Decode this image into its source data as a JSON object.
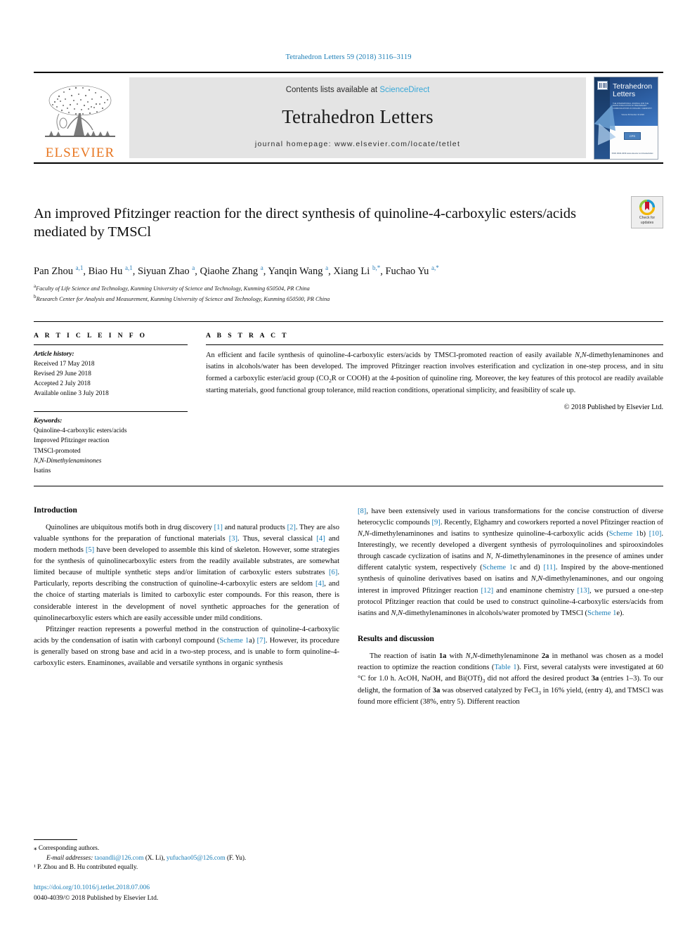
{
  "running_head": "Tetrahedron Letters 59 (2018) 3116–3119",
  "masthead": {
    "publisher_word": "ELSEVIER",
    "contents_prefix": "Contents lists available at ",
    "contents_link": "ScienceDirect",
    "journal_name": "Tetrahedron Letters",
    "homepage_prefix": "journal homepage: ",
    "homepage_url": "www.elsevier.com/locate/tetlet",
    "cover": {
      "title_line1": "Tetrahedron",
      "title_line2": "Letters",
      "sub_line": "THE INTERNATIONAL JOURNAL FOR THE RAPID PUBLICATION OF PRELIMINARY COMMUNICATIONS IN ORGANIC CHEMISTRY",
      "volume_line": "Volume 59   Number 33   2018",
      "blurb": "Available online at www.sciencedirect.com — rapid publication of preliminary communications in organic chemistry",
      "chip_label": "CPS",
      "foot_line": "ISSN 0040-4039\nwww.elsevier.com/locate/tetlet"
    }
  },
  "title": "An improved Pfitzinger reaction for the direct synthesis of quinoline-4-carboxylic esters/acids mediated by TMSCl",
  "crossmark": {
    "label_line1": "Check for",
    "label_line2": "updates"
  },
  "authors_html": "Pan Zhou <sup>a,1</sup>, Biao Hu <sup>a,1</sup>, Siyuan Zhao <sup>a</sup>, Qiaohe Zhang <sup>a</sup>, Yanqin Wang <sup>a</sup>, Xiang Li <sup>b,*</sup>, Fuchao Yu <sup>a,*</sup>",
  "affiliations": [
    {
      "marker": "a",
      "text": "Faculty of Life Science and Technology, Kunming University of Science and Technology, Kunming 650504, PR China"
    },
    {
      "marker": "b",
      "text": "Research Center for Analysis and Measurement, Kunming University of Science and Technology, Kunming 650500, PR China"
    }
  ],
  "article_info": {
    "heading": "A R T I C L E  I N F O",
    "history_label": "Article history:",
    "history": [
      "Received 17 May 2018",
      "Revised 29 June 2018",
      "Accepted 2 July 2018",
      "Available online 3 July 2018"
    ],
    "keywords_label": "Keywords:",
    "keywords": [
      "Quinoline-4-carboxylic esters/acids",
      "Improved Pfitzinger reaction",
      "TMSCl-promoted",
      "N,N-Dimethylenaminones",
      "Isatins"
    ]
  },
  "abstract": {
    "heading": "A B S T R A C T",
    "text_html": "An efficient and facile synthesis of quinoline-4-carboxylic esters/acids by TMSCl-promoted reaction of easily available <em>N,N</em>-dimethylenaminones and isatins in alcohols/water has been developed. The improved Pfitzinger reaction involves esterification and cyclization in one-step process, and in situ formed a carboxylic ester/acid group (CO<sub>2</sub>R or COOH) at the 4-position of quinoline ring. Moreover, the key features of this protocol are readily available starting materials, good functional group tolerance, mild reaction conditions, operational simplicity, and feasibility of scale up.",
    "copyright": "© 2018 Published by Elsevier Ltd."
  },
  "sections": {
    "introduction_heading": "Introduction",
    "intro_p1_html": "Quinolines are ubiquitous motifs both in drug discovery <span class=\"ref\">[1]</span> and natural products <span class=\"ref\">[2]</span>. They are also valuable synthons for the preparation of functional materials <span class=\"ref\">[3]</span>. Thus, several classical <span class=\"ref\">[4]</span> and modern methods <span class=\"ref\">[5]</span> have been developed to assemble this kind of skeleton. However, some strategies for the synthesis of quinolinecarboxylic esters from the readily available substrates, are somewhat limited because of multiple synthetic steps and/or limitation of carboxylic esters substrates <span class=\"ref\">[6]</span>. Particularly, reports describing the construction of quinoline-4-carboxylic esters are seldom <span class=\"ref\">[4]</span>, and the choice of starting materials is limited to carboxylic ester compounds. For this reason, there is considerable interest in the development of novel synthetic approaches for the generation of quinolinecarboxylic esters which are easily accessible under mild conditions.",
    "intro_p2_html": "Pfitzinger reaction represents a powerful method in the construction of quinoline-4-carboxylic acids by the condensation of isatin with carbonyl compound (<span class=\"lnk\">Scheme 1</span>a) <span class=\"ref\">[7]</span>. However, its procedure is generally based on strong base and acid in a two-step process, and is unable to form quinoline-4-carboxylic esters. Enaminones, available and versatile synthons in organic synthesis",
    "intro_p2_cont_html": "<span class=\"ref\">[8]</span>, have been extensively used in various transformations for the concise construction of diverse heterocyclic compounds <span class=\"ref\">[9]</span>. Recently, Elghamry and coworkers reported a novel Pfitzinger reaction of <em>N,N</em>-dimethylenaminones and isatins to synthesize quinoline-4-carboxylic acids (<span class=\"lnk\">Scheme 1</span>b) <span class=\"ref\">[10]</span>. Interestingly, we recently developed a divergent synthesis of pyrroloquinolines and spirooxindoles through cascade cyclization of isatins and <em>N, N</em>-dimethylenaminones in the presence of amines under different catalytic system, respectively (<span class=\"lnk\">Scheme 1</span>c and d) <span class=\"ref\">[11]</span>. Inspired by the above-mentioned synthesis of quinoline derivatives based on isatins and <em>N,N</em>-dimethylenaminones, and our ongoing interest in improved Pfitzinger reaction <span class=\"ref\">[12]</span> and enaminone chemistry <span class=\"ref\">[13]</span>, we pursued a one-step protocol Pfitzinger reaction that could be used to construct quinoline-4-carboxylic esters/acids from isatins and <em>N,N</em>-dimethylenaminones in alcohols/water promoted by TMSCl (<span class=\"lnk\">Scheme 1</span>e).",
    "results_heading": "Results and discussion",
    "results_p1_html": "The reaction of isatin <strong>1a</strong> with <em>N,N</em>-dimethylenaminone <strong>2a</strong> in methanol was chosen as a model reaction to optimize the reaction conditions (<span class=\"lnk\">Table 1</span>). First, several catalysts were investigated at 60 °C for 1.0 h. AcOH, NaOH, and Bi(OTf)<sub>3</sub> did not afford the desired product <strong>3a</strong> (entries 1–3). To our delight, the formation of <strong>3a</strong> was observed catalyzed by FeCl<sub>3</sub> in 16% yield, (entry 4), and TMSCl was found more efficient (38%, entry 5). Different reaction"
  },
  "footnotes": {
    "corresponding": "⁎ Corresponding authors.",
    "email_label": "E-mail addresses:",
    "email1": "taoandli@126.com",
    "email1_owner": "(X. Li),",
    "email2": "yufuchao05@126.com",
    "email2_owner": "(F. Yu).",
    "equal_contrib": "¹ P. Zhou and B. Hu contributed equally.",
    "doi": "https://doi.org/10.1016/j.tetlet.2018.07.006",
    "issn_line": "0040-4039/© 2018 Published by Elsevier Ltd."
  },
  "colors": {
    "link_blue": "#1a7db6",
    "sciencedirect_blue": "#38a8d8",
    "elsevier_orange": "#e87722",
    "masthead_grey": "#e4e4e4"
  }
}
